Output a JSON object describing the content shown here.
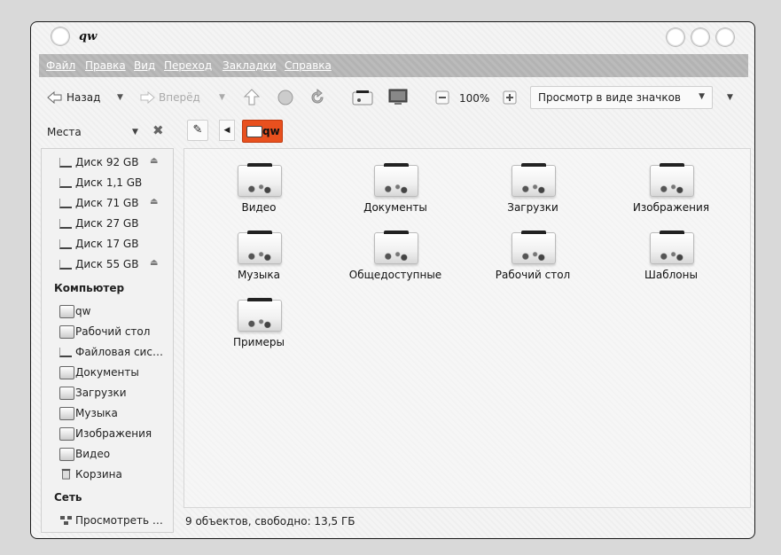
{
  "window": {
    "title": "qw"
  },
  "menu": [
    "Файл",
    "Правка",
    "Вид",
    "Переход",
    "Закладки",
    "Справка"
  ],
  "toolbar": {
    "back_label": "Назад",
    "forward_label": "Вперёд",
    "zoom_value": "100%",
    "view_mode": "Просмотр в виде значков"
  },
  "places": {
    "header_label": "Места",
    "drives": [
      {
        "label": "Диск 92 GB",
        "eject": true
      },
      {
        "label": "Диск 1,1 GB",
        "eject": false
      },
      {
        "label": "Диск 71 GB",
        "eject": true
      },
      {
        "label": "Диск 27 GB",
        "eject": false
      },
      {
        "label": "Диск 17 GB",
        "eject": false
      },
      {
        "label": "Диск 55 GB",
        "eject": true
      }
    ],
    "computer_heading": "Компьютер",
    "computer_items": [
      "qw",
      "Рабочий стол",
      "Файловая система",
      "Документы",
      "Загрузки",
      "Музыка",
      "Изображения",
      "Видео",
      "Корзина"
    ],
    "network_heading": "Сеть",
    "network_items": [
      "Просмотреть сеть"
    ]
  },
  "path": {
    "current": "qw"
  },
  "folders": [
    "Видео",
    "Документы",
    "Загрузки",
    "Изображения",
    "Музыка",
    "Общедоступные",
    "Рабочий стол",
    "Шаблоны",
    "Примеры"
  ],
  "status": {
    "text": "9 объектов, свободно: 13,5 ГБ"
  }
}
